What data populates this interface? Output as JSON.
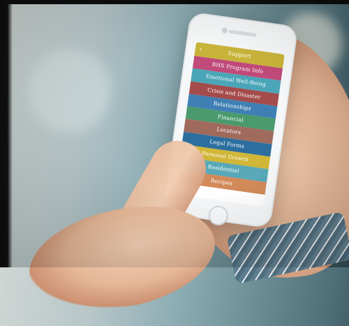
{
  "app": {
    "header": {
      "back_symbol": "‹",
      "title": "Support"
    },
    "menu_items": [
      "BHS Program Info",
      "Emotional Well-Being",
      "Crisis and Disaster",
      "Relationships",
      "Financial",
      "Locators",
      "Legal Forms",
      "Personal Growth",
      "Residential",
      "Recipes"
    ],
    "colors": {
      "header": "#c8b33a",
      "rows": [
        "#c04a7a",
        "#4aa5b8",
        "#a44b4b",
        "#3f7fb4",
        "#4a9a6d",
        "#a06a5c",
        "#2c6f9f",
        "#d1b637",
        "#58a8b7",
        "#d28a5a"
      ]
    }
  }
}
